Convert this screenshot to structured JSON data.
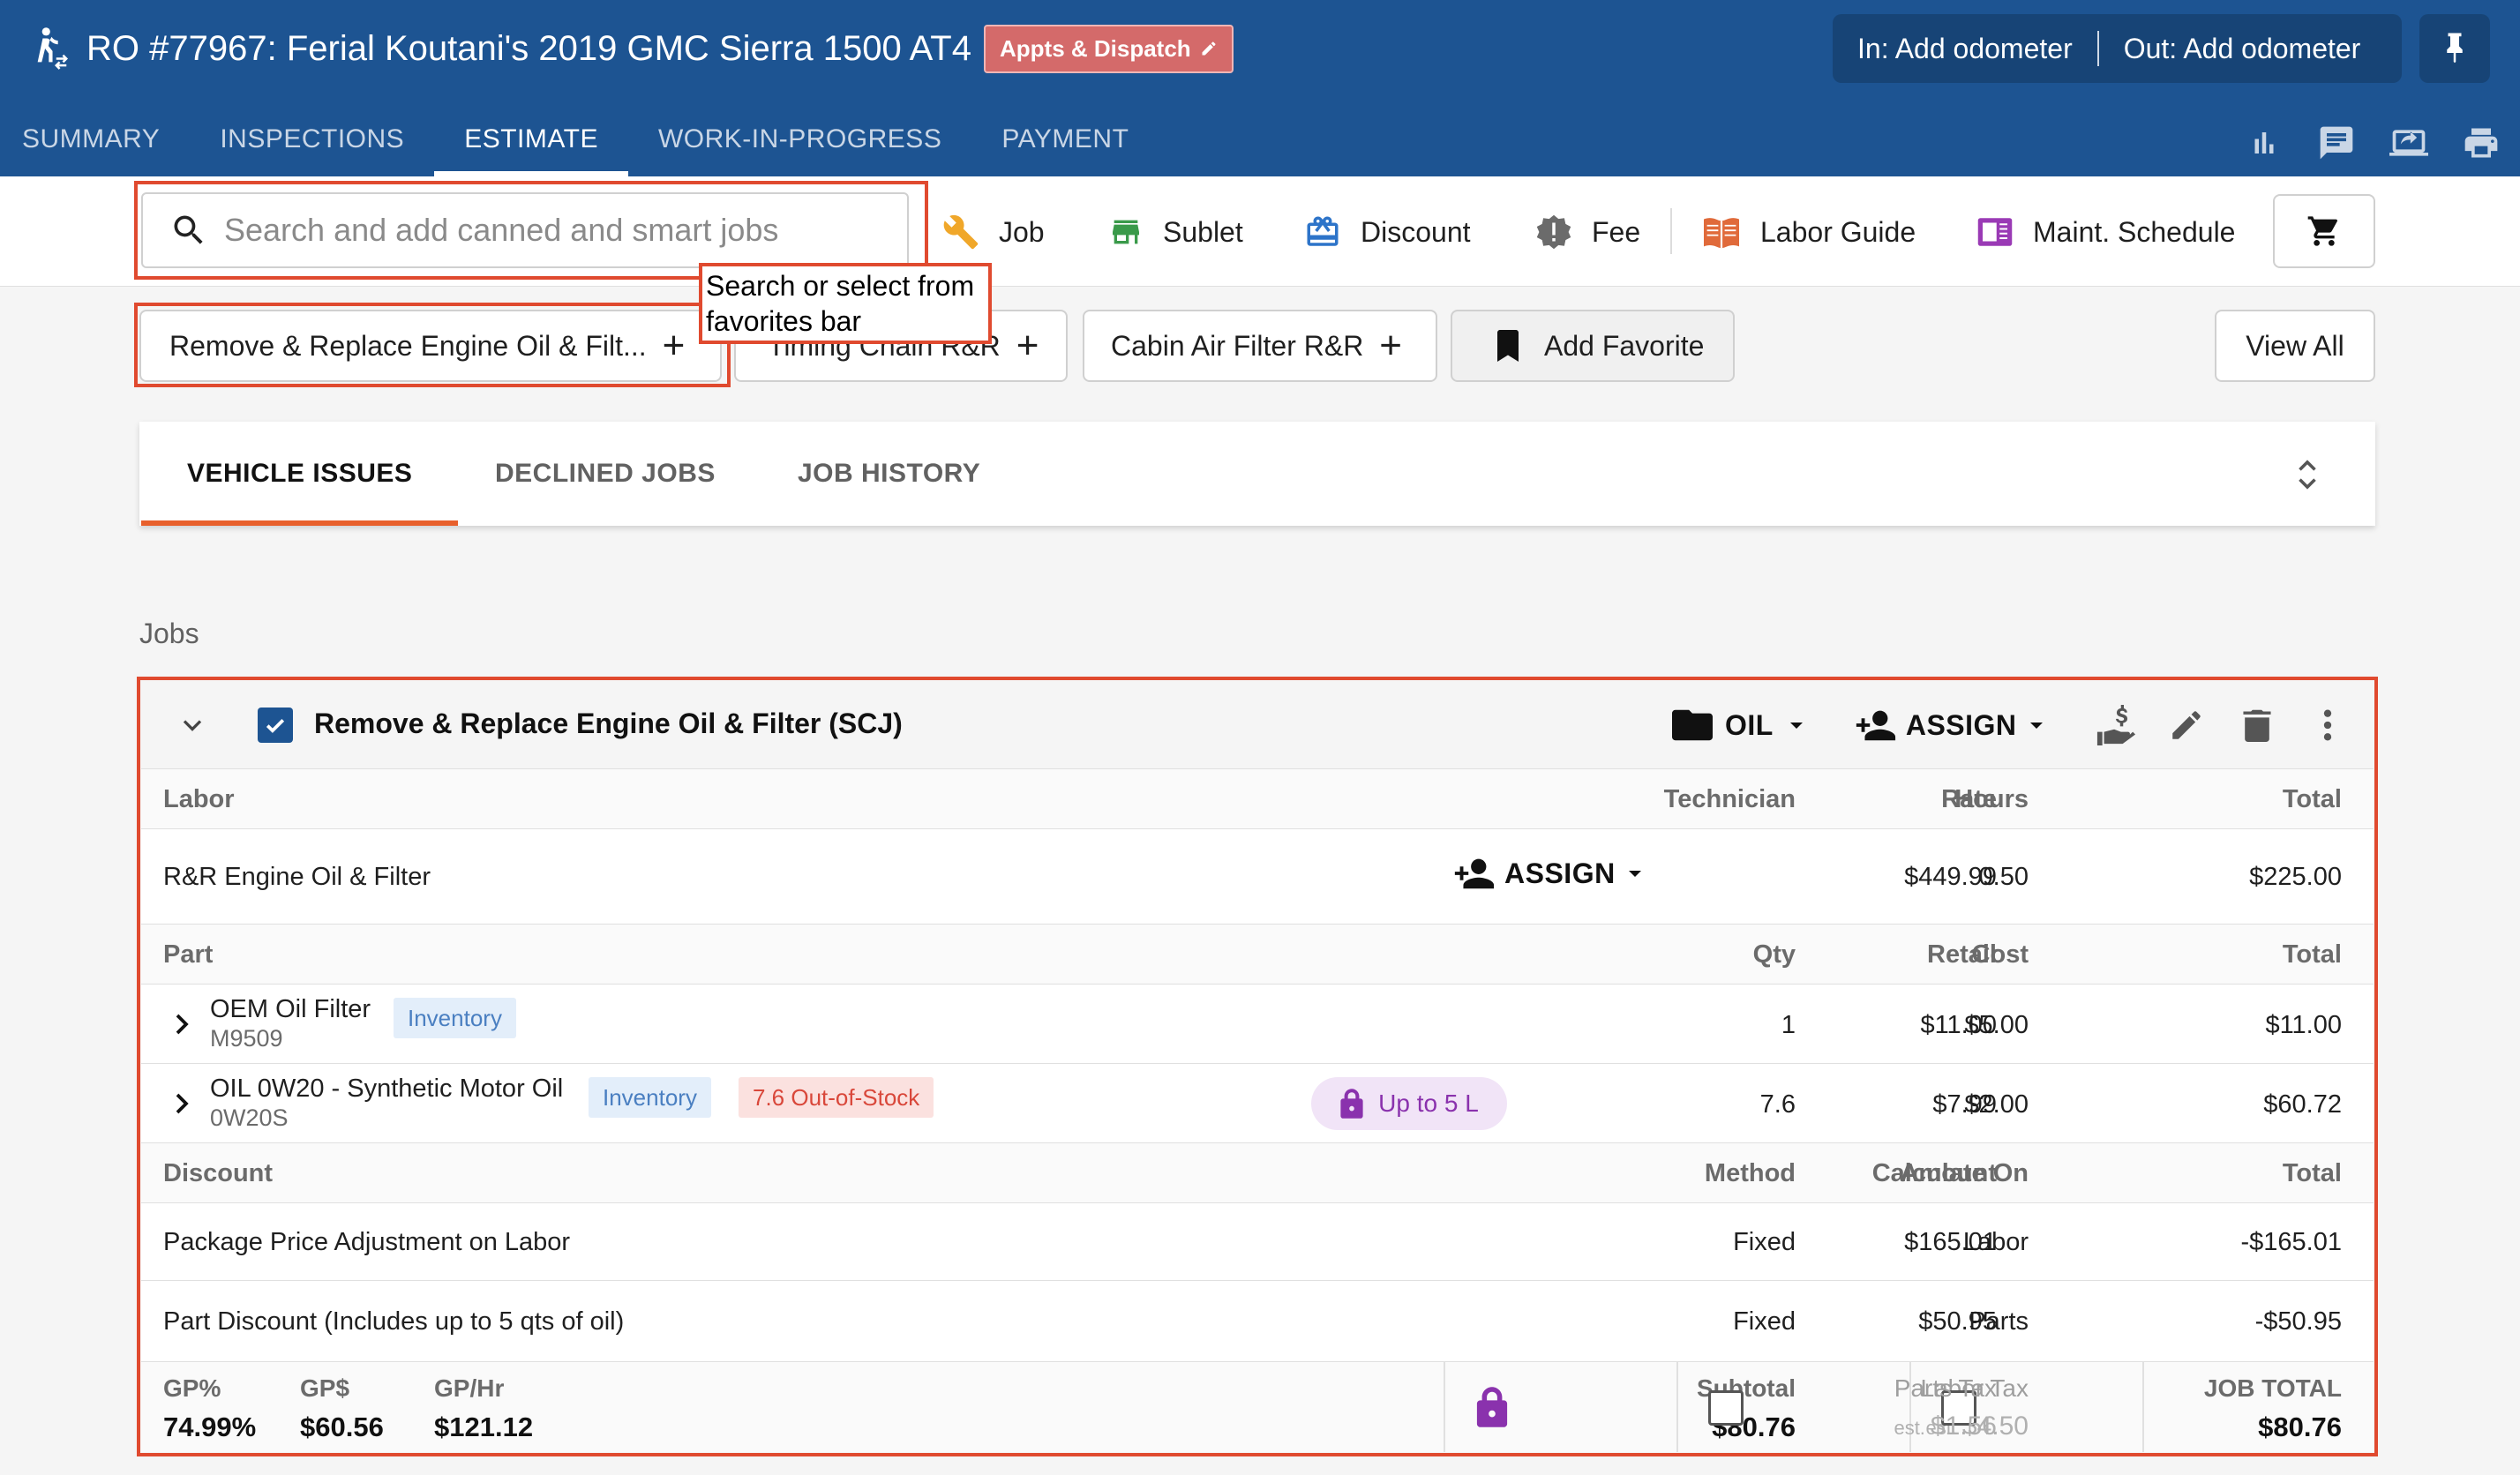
{
  "header": {
    "title": "RO #77967: Ferial Koutani's 2019 GMC Sierra 1500 AT4",
    "badge": "Appts & Dispatch",
    "odometer_in": "In: Add odometer",
    "odometer_out": "Out: Add odometer",
    "tabs": [
      "SUMMARY",
      "INSPECTIONS",
      "ESTIMATE",
      "WORK-IN-PROGRESS",
      "PAYMENT"
    ],
    "active_tab": "ESTIMATE"
  },
  "toolbar": {
    "search_placeholder": "Search and add canned and smart jobs",
    "job": "Job",
    "sublet": "Sublet",
    "discount": "Discount",
    "fee": "Fee",
    "labor_guide": "Labor Guide",
    "maint_schedule": "Maint. Schedule"
  },
  "annotation": "Search or select from favorites bar",
  "favorites": {
    "items": [
      "Remove & Replace Engine Oil & Filt...",
      "Timing Chain R&R",
      "Cabin Air Filter R&R"
    ],
    "add_favorite": "Add Favorite",
    "view_all": "View All"
  },
  "issue_tabs": [
    "VEHICLE ISSUES",
    "DECLINED JOBS",
    "JOB HISTORY"
  ],
  "jobs_label": "Jobs",
  "job": {
    "title": "Remove & Replace Engine Oil & Filter (SCJ)",
    "category": "OIL",
    "assign": "ASSIGN",
    "labor_headers": {
      "name": "Labor",
      "technician": "Technician",
      "hours": "Hours",
      "rate": "Rate",
      "total": "Total"
    },
    "labor": {
      "name": "R&R Engine Oil & Filter",
      "assign": "ASSIGN",
      "hours": "0.50",
      "rate": "$449.99",
      "total": "$225.00"
    },
    "part_headers": {
      "name": "Part",
      "qty": "Qty",
      "cost": "Cost",
      "retail": "Retail",
      "total": "Total"
    },
    "parts": [
      {
        "name": "OEM Oil Filter",
        "number": "M9509",
        "tag": "Inventory",
        "qty": "1",
        "cost": "$5.00",
        "retail": "$11.00",
        "total": "$11.00"
      },
      {
        "name": "OIL 0W20 - Synthetic Motor Oil",
        "number": "0W20S",
        "tag": "Inventory",
        "stock": "7.6 Out-of-Stock",
        "pill": "Up to 5 L",
        "qty": "7.6",
        "cost": "$2.00",
        "retail": "$7.99",
        "total": "$60.72"
      }
    ],
    "discount_headers": {
      "name": "Discount",
      "method": "Method",
      "calc": "Calculate On",
      "amount": "Amount",
      "total": "Total"
    },
    "discounts": [
      {
        "name": "Package Price Adjustment on Labor",
        "method": "Fixed",
        "calc": "Labor",
        "amount": "$165.01",
        "total": "-$165.01"
      },
      {
        "name": "Part Discount (Includes up to 5 qts of oil)",
        "method": "Fixed",
        "calc": "Parts",
        "amount": "$50.95",
        "total": "-$50.95"
      }
    ],
    "footer": {
      "gp_pct_label": "GP%",
      "gp_pct": "74.99%",
      "gp_usd_label": "GP$",
      "gp_usd": "$60.56",
      "gp_hr_label": "GP/Hr",
      "gp_hr": "$121.12",
      "subtotal_label": "Subtotal",
      "subtotal": "$80.76",
      "labor_tax_label": "Labor Tax",
      "labor_tax_est": "est.",
      "labor_tax": "$4.50",
      "parts_tax_label": "Parts Tax",
      "parts_tax_est": "est.",
      "parts_tax": "$1.56",
      "job_total_label": "JOB TOTAL",
      "job_total": "$80.76"
    }
  },
  "colors": {
    "header": "#1d5492",
    "accent": "#e8602c",
    "annotation": "#e04a2f",
    "lock": "#8a32ad"
  }
}
